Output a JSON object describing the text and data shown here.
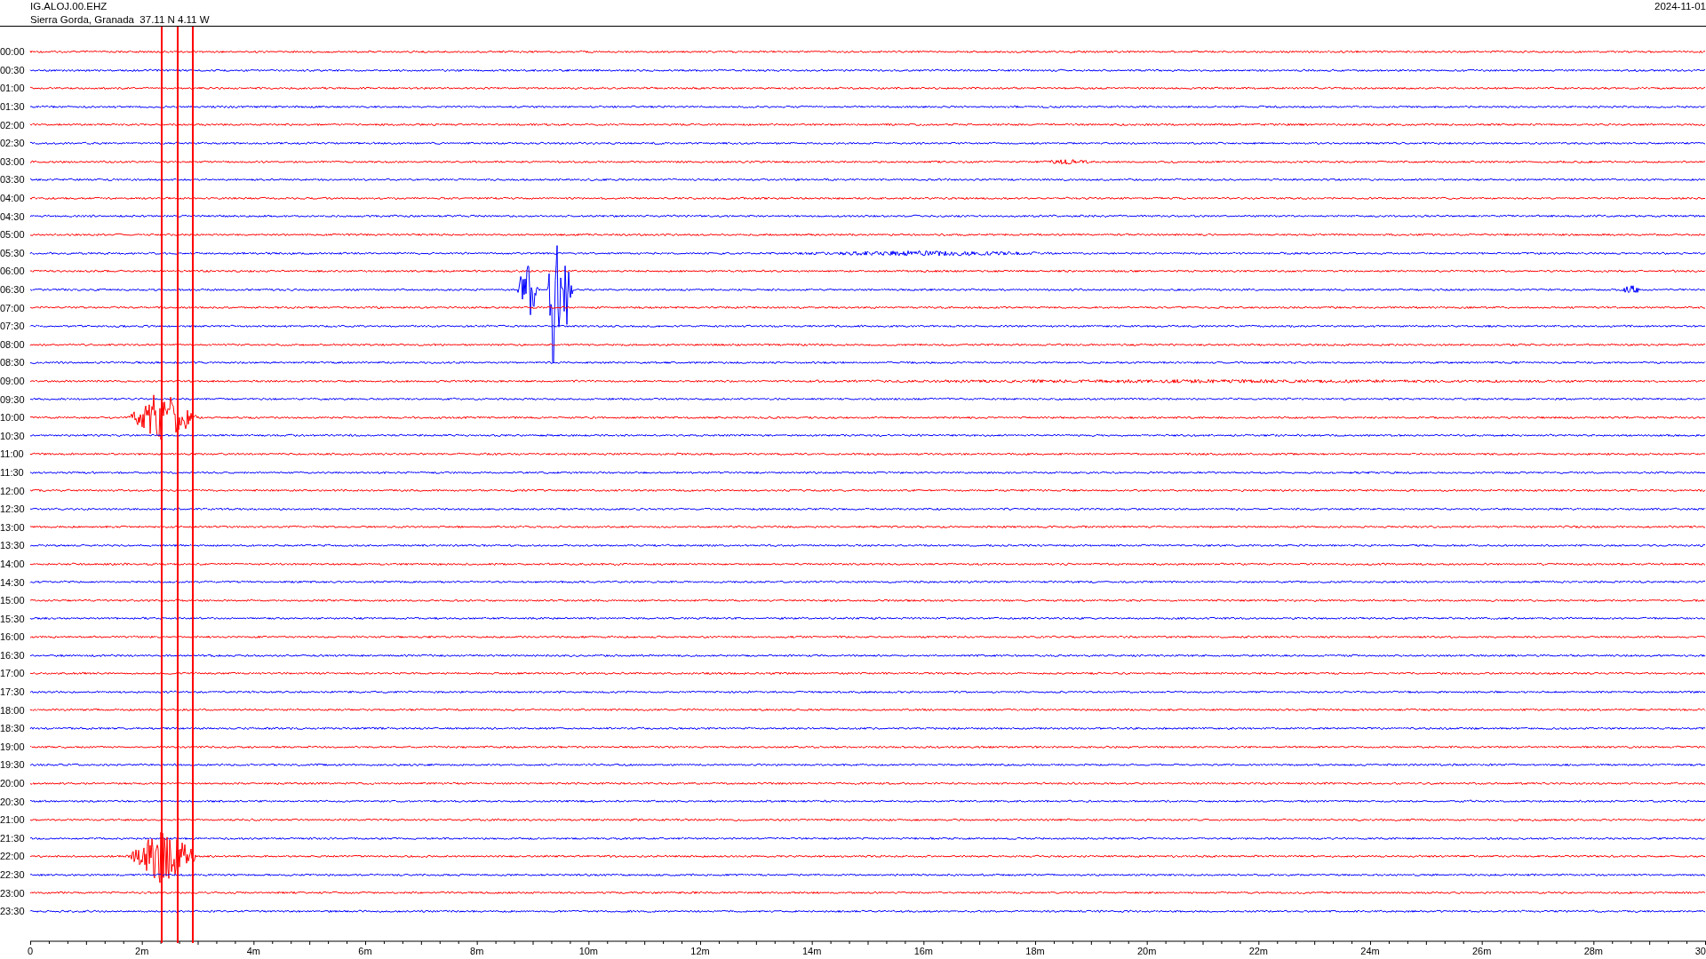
{
  "header": {
    "station": "IG.ALOJ.00.EHZ",
    "location": "Sierra Gorda, Granada  37.11 N 4.11 W",
    "date": "2024-11-01"
  },
  "traces": [
    {
      "time": "00:00",
      "color": "#ff0000"
    },
    {
      "time": "00:30",
      "color": "#0000ff"
    },
    {
      "time": "01:00",
      "color": "#ff0000"
    },
    {
      "time": "01:30",
      "color": "#0000ff"
    },
    {
      "time": "02:00",
      "color": "#ff0000"
    },
    {
      "time": "02:30",
      "color": "#0000ff"
    },
    {
      "time": "03:00",
      "color": "#ff0000"
    },
    {
      "time": "03:30",
      "color": "#0000ff"
    },
    {
      "time": "04:00",
      "color": "#ff0000"
    },
    {
      "time": "04:30",
      "color": "#0000ff"
    },
    {
      "time": "05:00",
      "color": "#ff0000"
    },
    {
      "time": "05:30",
      "color": "#0000ff"
    },
    {
      "time": "06:00",
      "color": "#ff0000"
    },
    {
      "time": "06:30",
      "color": "#0000ff"
    },
    {
      "time": "07:00",
      "color": "#ff0000"
    },
    {
      "time": "07:30",
      "color": "#0000ff"
    },
    {
      "time": "08:00",
      "color": "#ff0000"
    },
    {
      "time": "08:30",
      "color": "#0000ff"
    },
    {
      "time": "09:00",
      "color": "#ff0000"
    },
    {
      "time": "09:30",
      "color": "#0000ff"
    },
    {
      "time": "10:00",
      "color": "#ff0000"
    },
    {
      "time": "10:30",
      "color": "#0000ff"
    },
    {
      "time": "11:00",
      "color": "#ff0000"
    },
    {
      "time": "11:30",
      "color": "#0000ff"
    },
    {
      "time": "12:00",
      "color": "#ff0000"
    },
    {
      "time": "12:30",
      "color": "#0000ff"
    },
    {
      "time": "13:00",
      "color": "#ff0000"
    },
    {
      "time": "13:30",
      "color": "#0000ff"
    },
    {
      "time": "14:00",
      "color": "#ff0000"
    },
    {
      "time": "14:30",
      "color": "#0000ff"
    },
    {
      "time": "15:00",
      "color": "#ff0000"
    },
    {
      "time": "15:30",
      "color": "#0000ff"
    },
    {
      "time": "16:00",
      "color": "#ff0000"
    },
    {
      "time": "16:30",
      "color": "#0000ff"
    },
    {
      "time": "17:00",
      "color": "#ff0000"
    },
    {
      "time": "17:30",
      "color": "#0000ff"
    },
    {
      "time": "18:00",
      "color": "#ff0000"
    },
    {
      "time": "18:30",
      "color": "#0000ff"
    },
    {
      "time": "19:00",
      "color": "#ff0000"
    },
    {
      "time": "19:30",
      "color": "#0000ff"
    },
    {
      "time": "20:00",
      "color": "#ff0000"
    },
    {
      "time": "20:30",
      "color": "#0000ff"
    },
    {
      "time": "21:00",
      "color": "#ff0000"
    },
    {
      "time": "21:30",
      "color": "#0000ff"
    },
    {
      "time": "22:00",
      "color": "#ff0000"
    },
    {
      "time": "22:30",
      "color": "#0000ff"
    },
    {
      "time": "23:00",
      "color": "#ff0000"
    },
    {
      "time": "23:30",
      "color": "#0000ff"
    }
  ],
  "x_axis": {
    "ticks": [
      "0",
      "2m",
      "4m",
      "6m",
      "8m",
      "10m",
      "12m",
      "14m",
      "16m",
      "18m",
      "20m",
      "22m",
      "24m",
      "26m",
      "28m",
      "30"
    ]
  }
}
